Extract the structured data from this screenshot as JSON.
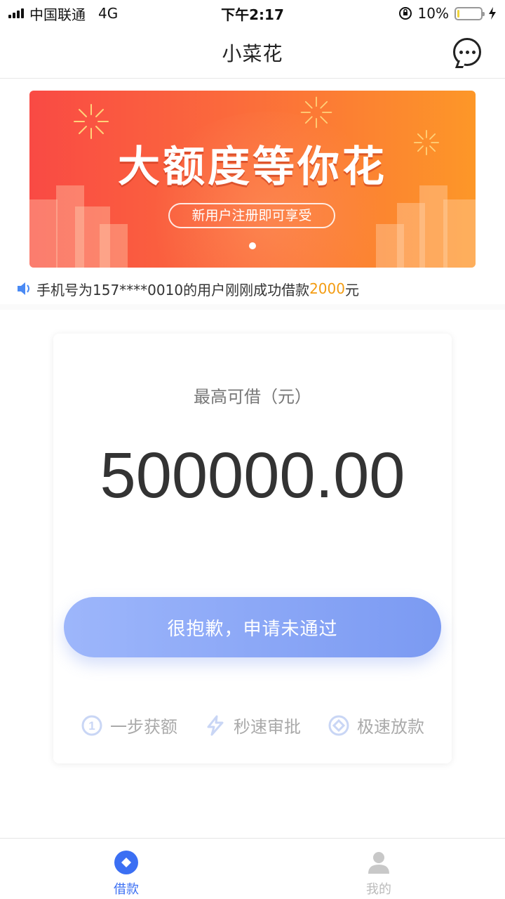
{
  "status_bar": {
    "carrier": "中国联通",
    "network": "4G",
    "time": "下午2:17",
    "battery_percent": "10%",
    "battery_level": 0.1
  },
  "nav": {
    "title": "小菜花",
    "more_icon": "chat-bubble-more-icon"
  },
  "banner": {
    "headline": "大额度等你花",
    "subtitle": "新用户注册即可享受",
    "gradient": [
      "#f94a44",
      "#fd9728"
    ],
    "active_slide": 1,
    "slide_count": 1
  },
  "notice": {
    "icon": "speaker-icon",
    "prefix": "手机号为157****0010的用户刚刚成功借款",
    "amount": "2000",
    "suffix": "元"
  },
  "loan_card": {
    "label": "最高可借（元）",
    "amount": "500000.00",
    "button_label": "很抱歉，申请未通过",
    "features": [
      {
        "icon": "number-one-circle-icon",
        "label": "一步获额"
      },
      {
        "icon": "lightning-icon",
        "label": "秒速审批"
      },
      {
        "icon": "diamond-circle-icon",
        "label": "极速放款"
      }
    ]
  },
  "tab_bar": {
    "tabs": [
      {
        "label": "借款",
        "icon": "loan-icon",
        "active": true
      },
      {
        "label": "我的",
        "icon": "user-icon",
        "active": false
      }
    ],
    "active_color": "#3b6ff3"
  }
}
